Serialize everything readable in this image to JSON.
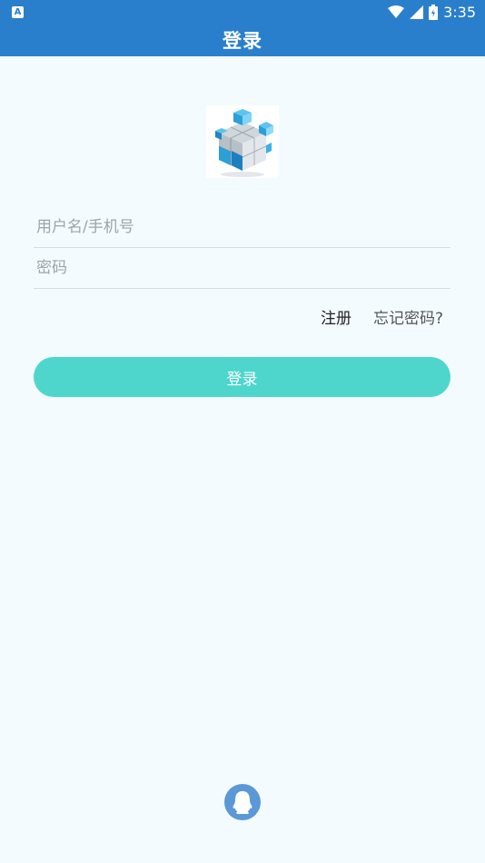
{
  "status_bar": {
    "time": "3:35",
    "app_indicator": "A",
    "icons": [
      "wifi-icon",
      "signal-icon",
      "battery-icon"
    ]
  },
  "app_bar": {
    "title": "登录"
  },
  "logo": {
    "icon": "cube-logo-icon"
  },
  "form": {
    "username_placeholder": "用户名/手机号",
    "username_value": "",
    "password_placeholder": "密码",
    "password_value": ""
  },
  "links": {
    "register": "注册",
    "forgot_password": "忘记密码?"
  },
  "login_button": {
    "label": "登录"
  },
  "social": {
    "qq_icon": "qq-icon"
  },
  "colors": {
    "primary": "#2a7fcd",
    "button": "#4ed6cd",
    "background": "#f3fbff",
    "qq": "#5b98d8"
  }
}
